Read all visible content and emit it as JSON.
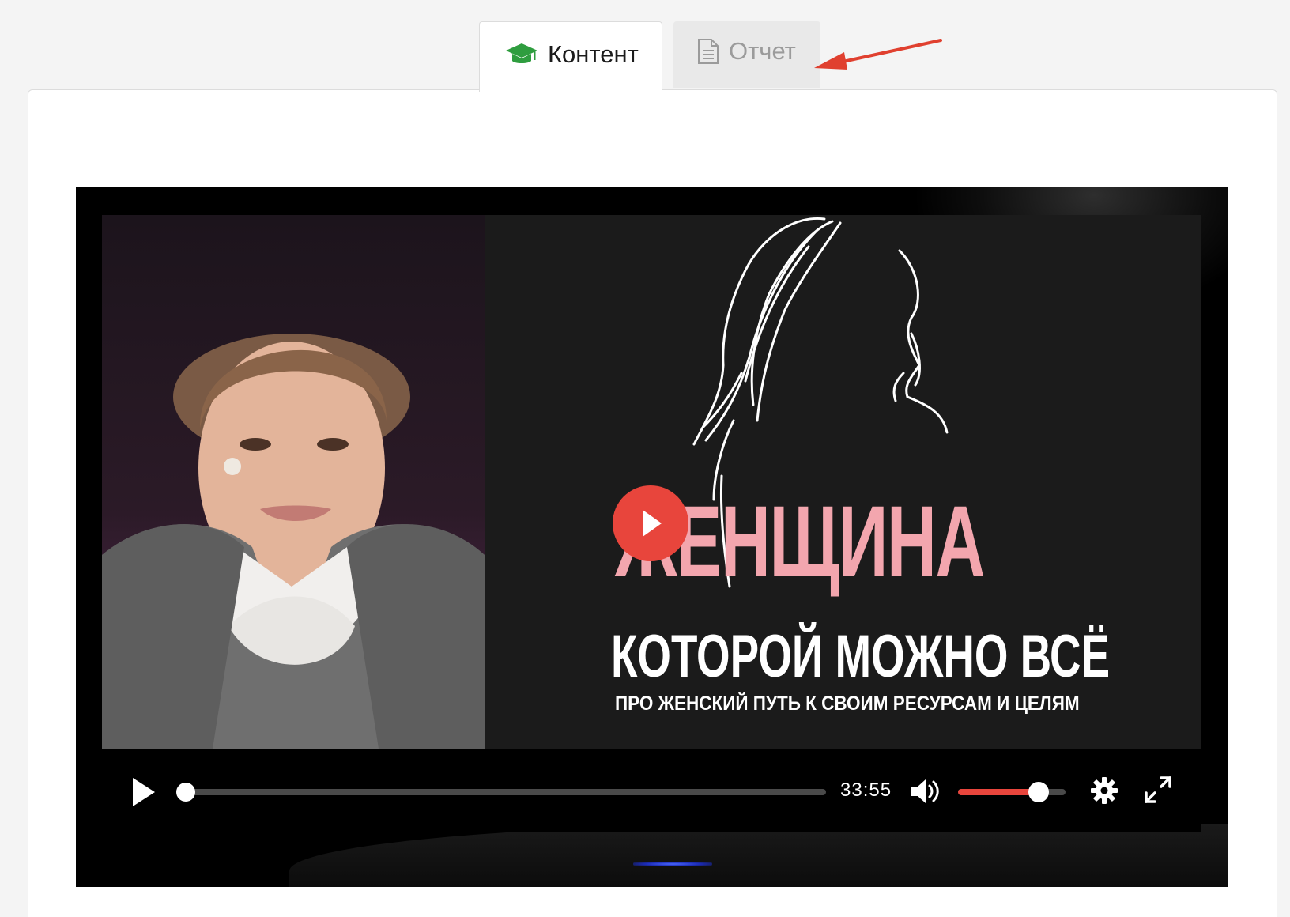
{
  "tabs": [
    {
      "label": "Контент",
      "icon": "graduation-cap-icon",
      "active": true,
      "icon_color": "#2f9d3f"
    },
    {
      "label": "Отчет",
      "icon": "document-icon",
      "active": false
    }
  ],
  "video": {
    "title_main": "ЖЕНЩИНА",
    "title_sub": "КОТОРОЙ МОЖНО ВСЁ",
    "tagline": "ПРО ЖЕНСКИЙ ПУТЬ К СВОИМ РЕСУРСАМ И ЦЕЛЯМ",
    "duration": "33:55",
    "progress": 0,
    "volume": 0.75,
    "accent_color": "#e8453c",
    "title_color": "#f3a6ae"
  },
  "controls": {
    "play_icon": "play-icon",
    "volume_icon": "volume-icon",
    "settings_icon": "gear-icon",
    "fullscreen_icon": "fullscreen-icon"
  },
  "annotation": {
    "type": "arrow",
    "color": "#e0402f",
    "target": "tab-report"
  }
}
